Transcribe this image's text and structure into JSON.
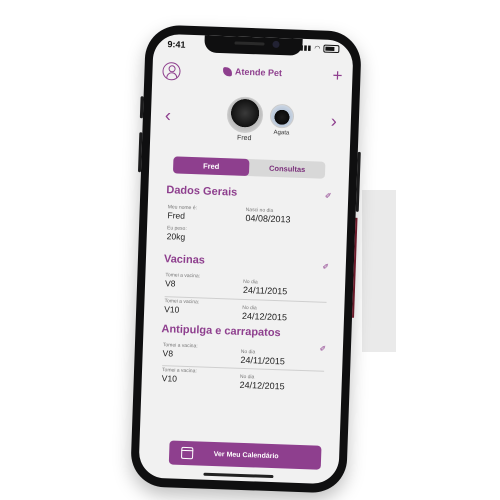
{
  "status_bar": {
    "time": "9:41"
  },
  "header": {
    "logo_text": "Atende Pet"
  },
  "pets": [
    {
      "name": "Fred"
    },
    {
      "name": "Agata"
    }
  ],
  "tabs": [
    {
      "label": "Fred",
      "active": true
    },
    {
      "label": "Consultas",
      "active": false
    }
  ],
  "general": {
    "title": "Dados Gerais",
    "name_label": "Meu nome é:",
    "name_value": "Fred",
    "birth_label": "Nasci no dia",
    "birth_value": "04/08/2013",
    "weight_label": "Eu peso:",
    "weight_value": "20kg"
  },
  "vaccines": {
    "title": "Vacinas",
    "items": [
      {
        "label": "Tomei a vacina:",
        "value": "V8",
        "date_label": "No dia",
        "date": "24/11/2015"
      },
      {
        "label": "Tomei a vacina:",
        "value": "V10",
        "date_label": "No dia",
        "date": "24/12/2015"
      }
    ]
  },
  "antiparasitic": {
    "title": "Antipulga e carrapatos",
    "items": [
      {
        "label": "Tomei a vacina:",
        "value": "V8",
        "date_label": "No dia",
        "date": "24/11/2015"
      },
      {
        "label": "Tomei a vacina:",
        "value": "V10",
        "date_label": "No dia",
        "date": "24/12/2015"
      }
    ]
  },
  "cta": {
    "label": "Ver Meu Calendário",
    "icon": "calendar-icon"
  },
  "colors": {
    "brand": "#8e3f8e",
    "background": "#f1f1f1"
  }
}
